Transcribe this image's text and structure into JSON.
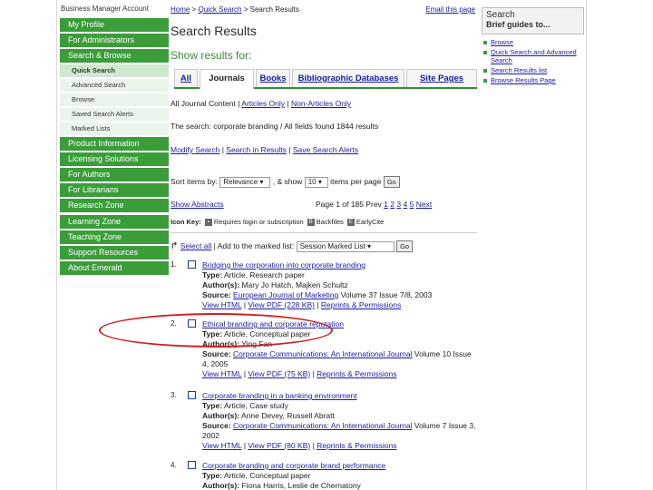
{
  "sidebar": {
    "site_title": "Business Manager Account",
    "items": [
      {
        "label": "My Profile"
      },
      {
        "label": "For Administrators"
      },
      {
        "label": "Search & Browse"
      }
    ],
    "sub_items": [
      {
        "label": "Quick Search"
      },
      {
        "label": "Advanced Search"
      },
      {
        "label": "Browse"
      },
      {
        "label": "Saved Search Alerts"
      },
      {
        "label": "Marked Lists"
      }
    ],
    "items_lower": [
      {
        "label": "Product Information"
      },
      {
        "label": "Licensing Solutions"
      },
      {
        "label": "For Authors"
      },
      {
        "label": "For Librarians"
      },
      {
        "label": "Research Zone"
      },
      {
        "label": "Learning Zone"
      },
      {
        "label": "Teaching Zone"
      },
      {
        "label": "Support Resources"
      },
      {
        "label": "About Emerald"
      }
    ]
  },
  "breadcrumb": {
    "home": "Home",
    "sep": " > ",
    "quick": "Quick Search",
    "current": "Search Results"
  },
  "email_link": "Email this page",
  "page_title": "Search Results",
  "results_for": "Show results for:",
  "tabs": [
    "All",
    "Journals",
    "Books",
    "Bibliographic Databases",
    "Site Pages"
  ],
  "filter": {
    "all_content": "All Journal Content",
    "sep": " | ",
    "articles": "Articles Only",
    "non_articles": "Non-Articles Only"
  },
  "search_summary": "The search: corporate branding / All fields found 1844 results",
  "actions": {
    "modify": "Modify Search",
    "within": "Search in Results",
    "save": "Save Search Alerts"
  },
  "sort": {
    "prefix": "Sort items by:",
    "value": "Relevance",
    "show_prefix": ", & show",
    "show_value": "10",
    "suffix": "items per page",
    "go": "Go"
  },
  "pagination": {
    "show_abstracts": "Show Abstracts",
    "page_text": "Page 1 of 185",
    "prev": "Prev",
    "pages": [
      "1",
      "2",
      "3",
      "4",
      "5"
    ],
    "next": "Next"
  },
  "icon_key": {
    "label": "Icon Key:",
    "login": "Requires login or subscription",
    "backfiles": "Backfiles",
    "earlycite": "EarlyCite"
  },
  "marked_list": {
    "select_all": "Select all",
    "add_to": "| Add to the marked list:",
    "value": "Session Marked List",
    "go": "Go"
  },
  "results": [
    {
      "num": "1.",
      "title": "Bridging the corporation into corporate branding",
      "type_label": "Type:",
      "type": "Article, Research paper",
      "authors_label": "Author(s):",
      "authors": "Mary Jo Hatch, Majken Schultz",
      "source_label": "Source:",
      "source": "European Journal of Marketing",
      "source_rest": " Volume 37 Issue 7/8, 2003",
      "links": {
        "html": "View HTML",
        "pdf": "View PDF (228 KB)",
        "reprints": "Reprints & Permissions"
      }
    },
    {
      "num": "2.",
      "title": "Ethical branding and corporate reputation",
      "type_label": "Type:",
      "type": "Article, Conceptual paper",
      "authors_label": "Author(s):",
      "authors": "Ying Fan",
      "source_label": "Source:",
      "source": "Corporate Communications: An International Journal",
      "source_rest": " Volume 10 Issue 4, 2005",
      "links": {
        "html": "View HTML",
        "pdf": "View PDF (75 KB)",
        "reprints": "Reprints & Permissions"
      }
    },
    {
      "num": "3.",
      "title": "Corporate branding in a banking environment",
      "type_label": "Type:",
      "type": "Article, Case study",
      "authors_label": "Author(s):",
      "authors": "Anne Devey, Russell Abratt",
      "source_label": "Source:",
      "source": "Corporate Communications: An International Journal",
      "source_rest": " Volume 7 Issue 3, 2002",
      "links": {
        "html": "View HTML",
        "pdf": "View PDF (80 KB)",
        "reprints": "Reprints & Permissions"
      }
    },
    {
      "num": "4.",
      "title": "Corporate branding and corporate brand performance",
      "type_label": "Type:",
      "type": "Article, Conceptual paper",
      "authors_label": "Author(s):",
      "authors": "Fiona Harris, Leslie de Chernatony"
    }
  ],
  "right": {
    "title": "Search",
    "subtitle": "Brief guides to...",
    "guides": [
      "Browse",
      "Quick Search and Advanced Search",
      "Search Results list",
      "Browse Results Page"
    ]
  },
  "colors": {
    "nav_green": "#3a9d3a",
    "link_blue": "#1a1aa6",
    "highlight_red": "#d21f1f"
  }
}
